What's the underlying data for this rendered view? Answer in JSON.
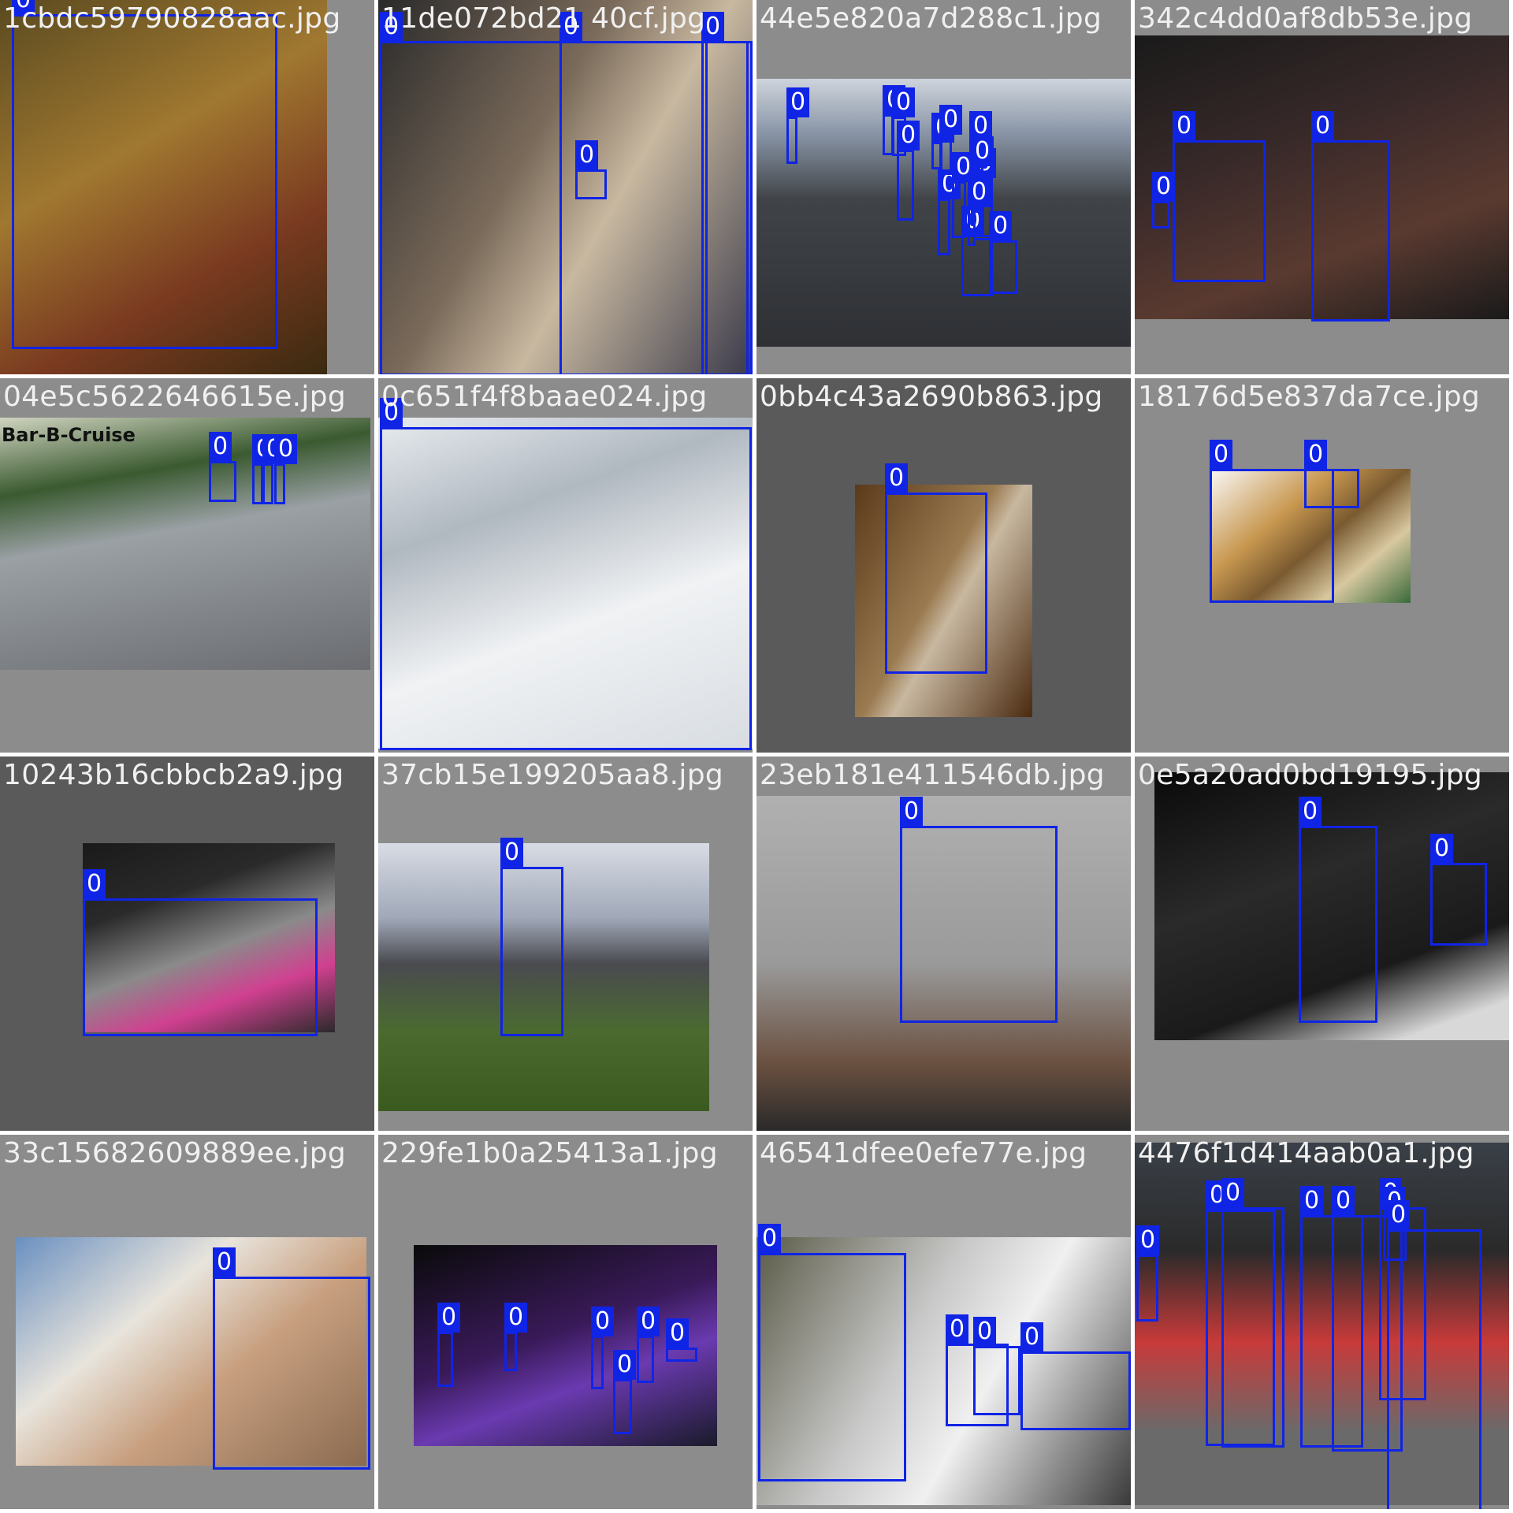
{
  "colors": {
    "box": "#1024e6",
    "tile_bg_light": "#8c8c8c",
    "tile_bg_dark": "#5a5a5a"
  },
  "box_label": "0",
  "tiles": [
    {
      "filename": "1cbdc59790828aac.jpg",
      "boxes": 1
    },
    {
      "filename": "11de072bd21 40cf.jpg",
      "boxes": 4
    },
    {
      "filename": "44e5e820a7d288c1.jpg",
      "boxes": 14
    },
    {
      "filename": "342c4dd0af8db53e.jpg",
      "boxes": 3
    },
    {
      "filename": "04e5c5622646615e.jpg",
      "boxes": 4,
      "photo_text": "Bar-B-Cruise"
    },
    {
      "filename": "0c651f4f8baae024.jpg",
      "boxes": 1
    },
    {
      "filename": "0bb4c43a2690b863.jpg",
      "boxes": 1
    },
    {
      "filename": "18176d5e837da7ce.jpg",
      "boxes": 2
    },
    {
      "filename": "10243b16cbbcb2a9.jpg",
      "boxes": 1
    },
    {
      "filename": "37cb15e199205aa8.jpg",
      "boxes": 1
    },
    {
      "filename": "23eb181e411546db.jpg",
      "boxes": 1
    },
    {
      "filename": "0e5a20ad0bd19195.jpg",
      "boxes": 2
    },
    {
      "filename": "33c15682609889ee.jpg",
      "boxes": 1
    },
    {
      "filename": "229fe1b0a25413a1.jpg",
      "boxes": 6
    },
    {
      "filename": "46541dfee0efe77e.jpg",
      "boxes": 4
    },
    {
      "filename": "4476f1d414aab0a1.jpg",
      "boxes": 8
    }
  ]
}
